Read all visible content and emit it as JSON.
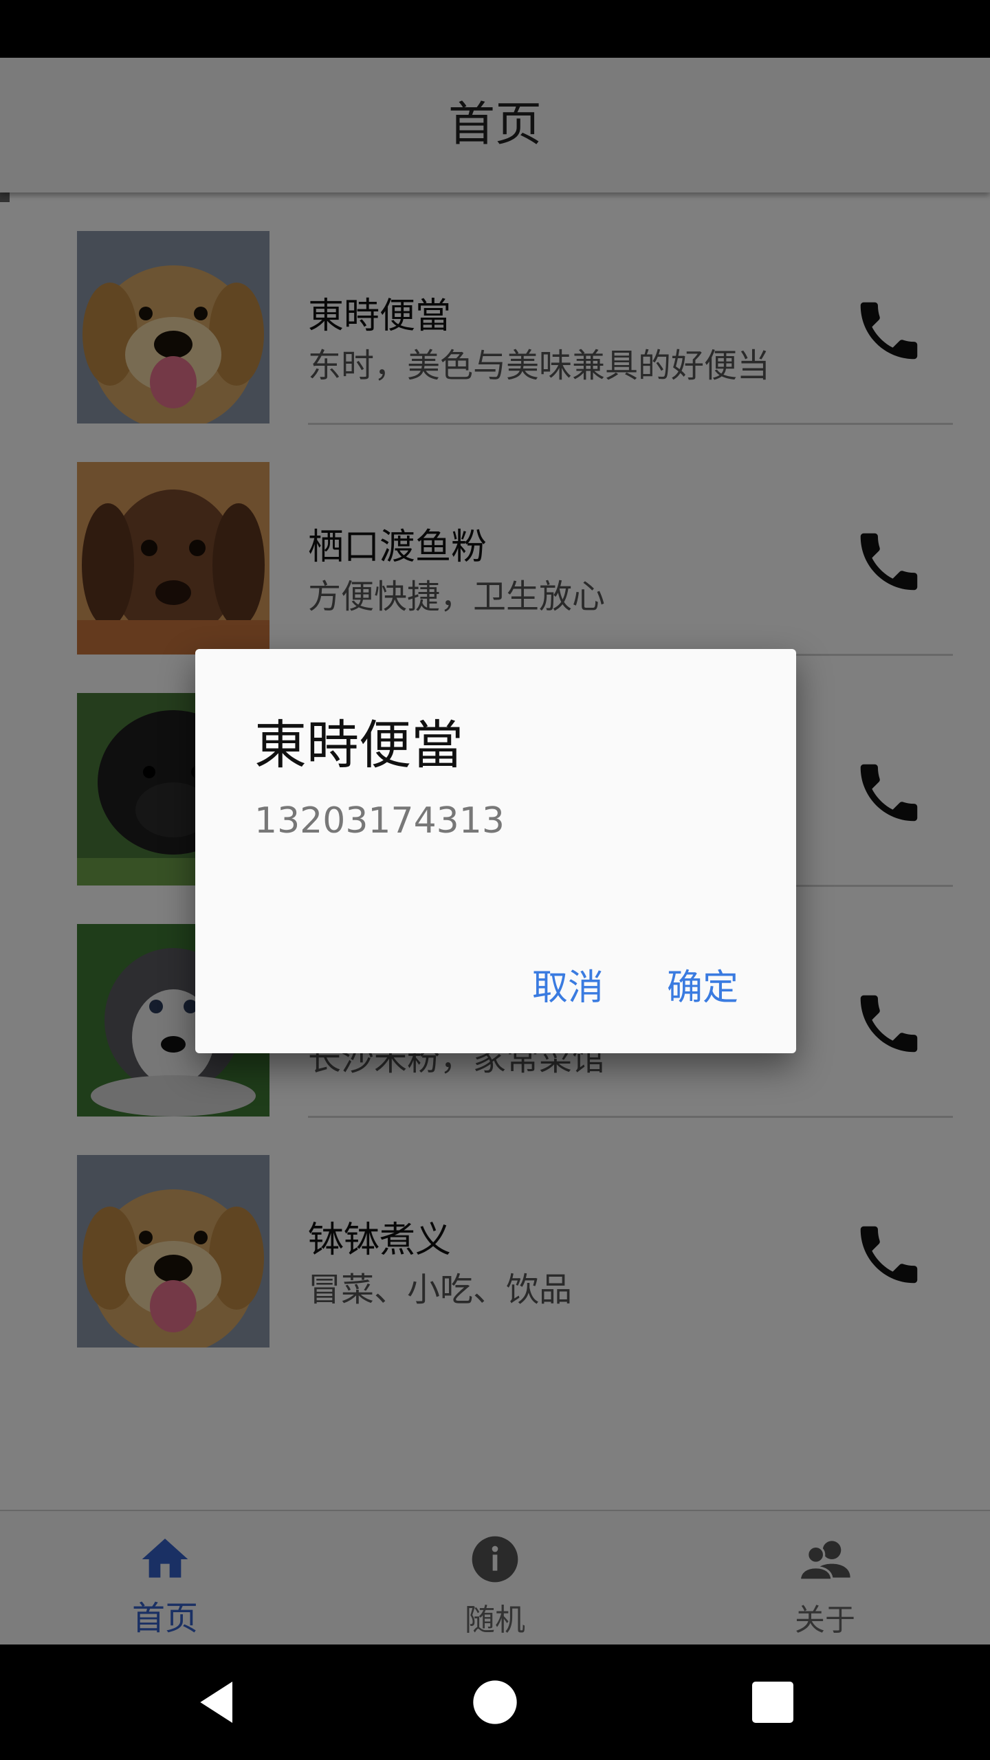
{
  "header": {
    "title": "首页"
  },
  "list": {
    "items": [
      {
        "name": "東時便當",
        "desc": "东时，美色与美味兼具的好便当",
        "thumb": "puppy-golden-icon"
      },
      {
        "name": "栖口渡鱼粉",
        "desc": "方便快捷，卫生放心",
        "thumb": "puppy-brown-icon"
      },
      {
        "name": "",
        "desc": "",
        "thumb": "puppy-black-icon"
      },
      {
        "name": "",
        "desc": "长沙米粉，家常菜馆",
        "thumb": "puppy-husky-icon"
      },
      {
        "name": "钵钵煮义",
        "desc": "冒菜、小吃、饮品",
        "thumb": "puppy-golden-icon"
      }
    ]
  },
  "dialog": {
    "title": "東時便當",
    "message": "13203174313",
    "cancel_label": "取消",
    "ok_label": "确定"
  },
  "bottom_nav": {
    "items": [
      {
        "label": "首页",
        "icon": "home-icon",
        "active": true
      },
      {
        "label": "随机",
        "icon": "info-icon",
        "active": false
      },
      {
        "label": "关于",
        "icon": "people-icon",
        "active": false
      }
    ]
  },
  "colors": {
    "accent": "#3460c8",
    "dialog_button": "#3a7be0",
    "scrim": "rgba(0,0,0,0.5)"
  }
}
